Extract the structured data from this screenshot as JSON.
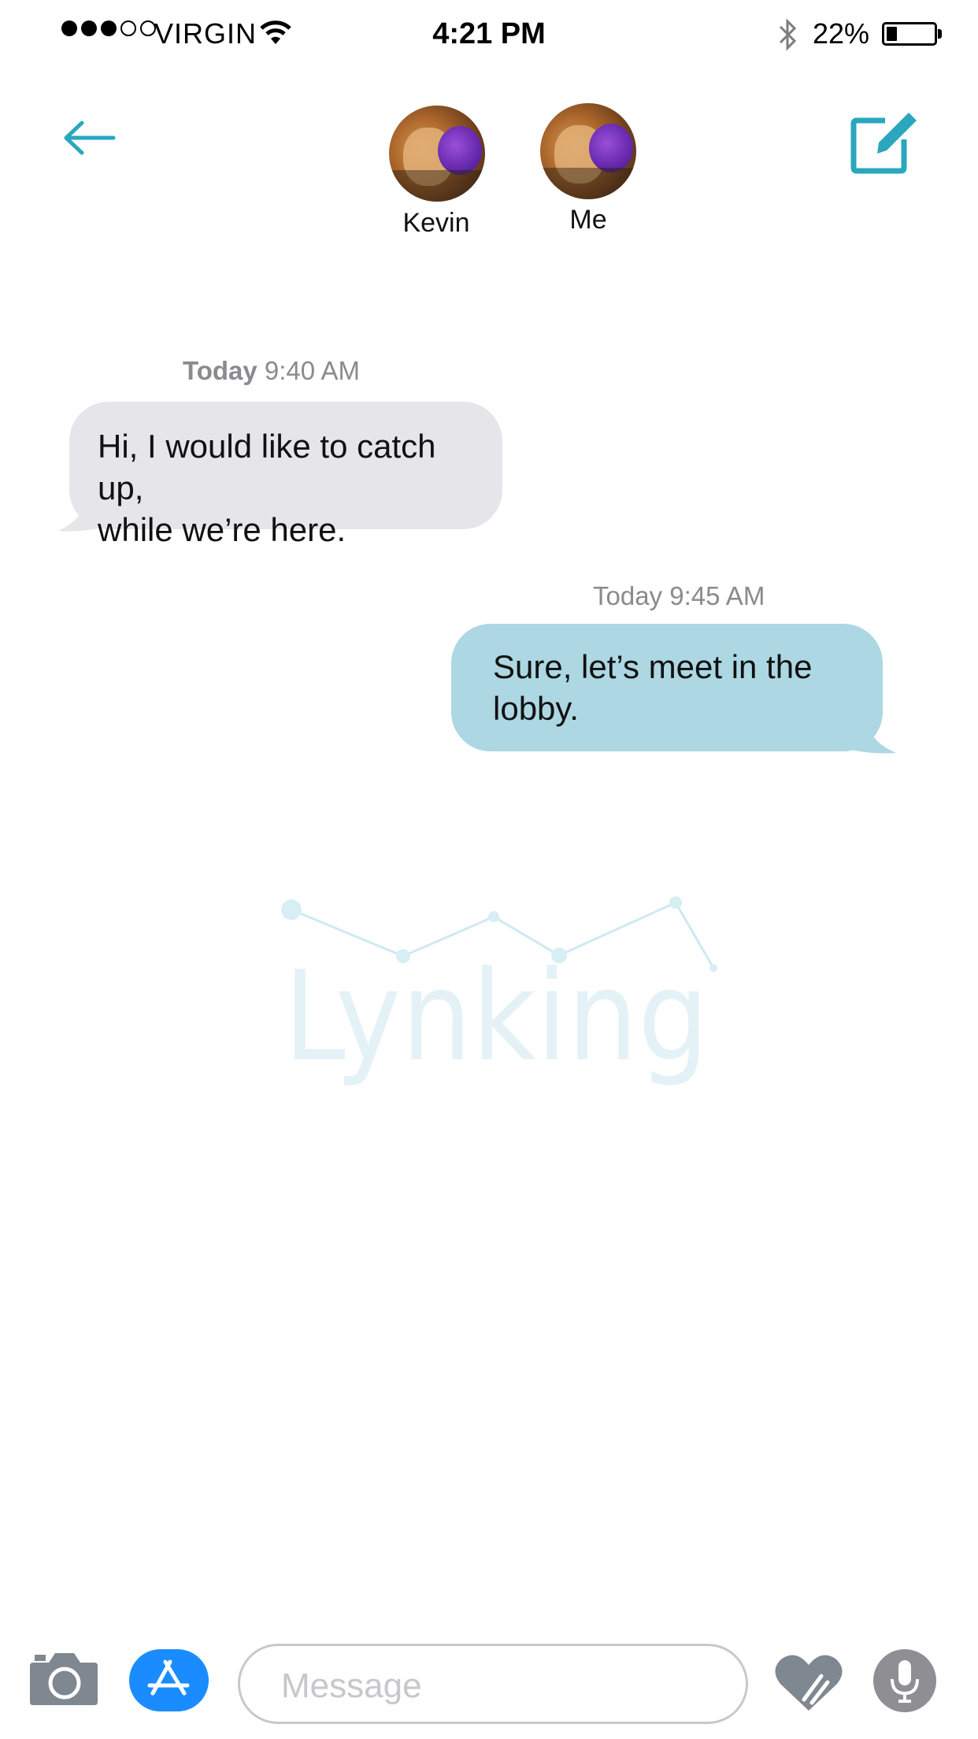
{
  "status_bar": {
    "carrier": "VIRGIN",
    "signal_bars": 3,
    "signal_total": 5,
    "time": "4:21 PM",
    "battery_percent_text": "22%",
    "battery_level": 0.22
  },
  "header": {
    "back_icon": "back-arrow-icon",
    "compose_icon": "compose-icon",
    "participants": [
      {
        "name": "Kevin"
      },
      {
        "name": "Me"
      }
    ]
  },
  "messages": [
    {
      "direction": "incoming",
      "timestamp_day": "Today",
      "timestamp_time": "9:40 AM",
      "text_line1": "Hi, I would like to catch up,",
      "text_line2": "while we’re here."
    },
    {
      "direction": "outgoing",
      "timestamp": "Today 9:45 AM",
      "text_line1": "Sure, let’s meet in the",
      "text_line2": "lobby."
    }
  ],
  "watermark": {
    "text": "Lynking"
  },
  "input_bar": {
    "placeholder": "Message",
    "icons": [
      "camera-icon",
      "app-store-icon",
      "heart-digital-touch-icon",
      "microphone-icon"
    ]
  },
  "colors": {
    "accent": "#2aa7bf",
    "incoming_bubble": "#e5e5ea",
    "outgoing_bubble": "#acd7e3",
    "app_store_blue": "#1a8cff"
  }
}
